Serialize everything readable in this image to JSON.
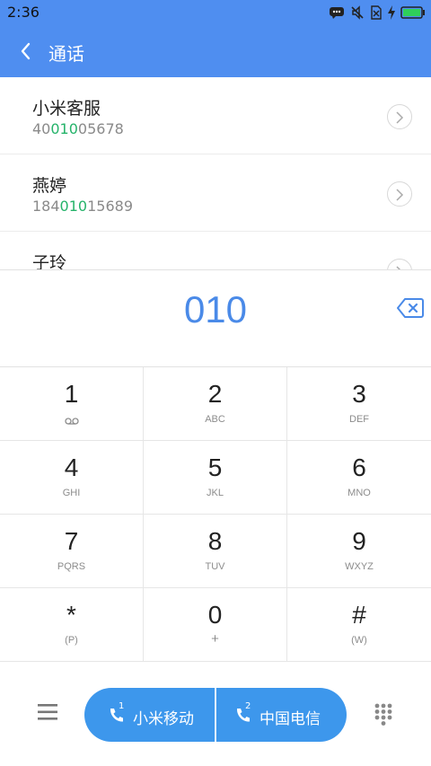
{
  "status_bar": {
    "time": "2:36",
    "icons": [
      "message-icon",
      "mute-icon",
      "no-sim-icon",
      "charging-icon",
      "battery-icon"
    ]
  },
  "appbar": {
    "title": "通话"
  },
  "contacts": [
    {
      "name": "小米客服",
      "number_pre": "40",
      "number_match": "010",
      "number_post": "05678"
    },
    {
      "name": "燕婷",
      "number_pre": "184",
      "number_match": "010",
      "number_post": "15689"
    },
    {
      "name": "子玲",
      "number_pre": "",
      "number_match": "",
      "number_post": ""
    }
  ],
  "input": {
    "digits": "010"
  },
  "keypad": [
    {
      "digit": "1",
      "sub": "",
      "sub_icon": "voicemail-icon"
    },
    {
      "digit": "2",
      "sub": "ABC"
    },
    {
      "digit": "3",
      "sub": "DEF"
    },
    {
      "digit": "4",
      "sub": "GHI"
    },
    {
      "digit": "5",
      "sub": "JKL"
    },
    {
      "digit": "6",
      "sub": "MNO"
    },
    {
      "digit": "7",
      "sub": "PQRS"
    },
    {
      "digit": "8",
      "sub": "TUV"
    },
    {
      "digit": "9",
      "sub": "WXYZ"
    },
    {
      "digit": "*",
      "sub": "(P)"
    },
    {
      "digit": "0",
      "sub": "+"
    },
    {
      "digit": "#",
      "sub": "(W)"
    }
  ],
  "call": {
    "sim1_label": "小米移动",
    "sim1_badge": "1",
    "sim2_label": "中国电信",
    "sim2_badge": "2"
  },
  "colors": {
    "appbar": "#4f8ef0",
    "digits": "#4a8ae8",
    "match_highlight": "#25b36a",
    "call_button": "#3d97ec"
  }
}
